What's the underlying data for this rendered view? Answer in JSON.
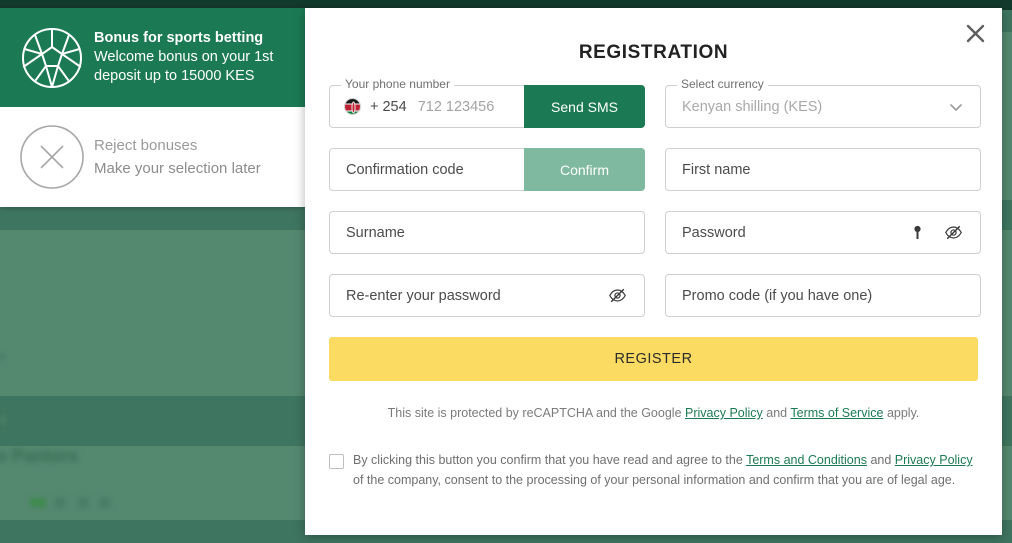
{
  "bonus_card": {
    "sports": {
      "icon": "soccer-ball-icon",
      "title": "Bonus for sports betting",
      "subtitle_line1": "Welcome bonus on your 1st",
      "subtitle_line2": "deposit up to 15000 KES"
    },
    "reject": {
      "icon": "circle-x-icon",
      "title": "Reject bonuses",
      "subtitle": "Make your selection later"
    }
  },
  "modal": {
    "title": "REGISTRATION",
    "close_icon": "close-icon",
    "phone": {
      "label": "Your phone number",
      "flag_icon": "kenya-flag-icon",
      "country_code": "+ 254",
      "placeholder": "712 123456",
      "button_label": "Send SMS"
    },
    "currency": {
      "label": "Select currency",
      "value": "Kenyan shilling (KES)",
      "chevron_icon": "chevron-down-icon"
    },
    "confirmation_code": {
      "placeholder": "Confirmation code",
      "button_label": "Confirm"
    },
    "first_name": {
      "placeholder": "First name"
    },
    "surname": {
      "placeholder": "Surname"
    },
    "password": {
      "placeholder": "Password",
      "key_icon": "key-icon",
      "toggle_icon": "eye-off-icon"
    },
    "reenter_password": {
      "placeholder": "Re-enter your password",
      "toggle_icon": "eye-off-icon"
    },
    "promo_code": {
      "placeholder": "Promo code (if you have one)"
    },
    "register_button": "REGISTER",
    "recaptcha": {
      "text_before": "This site is protected by reCAPTCHA and the Google ",
      "privacy_policy": "Privacy Policy",
      "text_middle": " and ",
      "terms_of_service": "Terms of Service",
      "text_after": " apply."
    },
    "terms": {
      "text_before": "By clicking this button you confirm that you have read and agree to the ",
      "terms_link": "Terms and Conditions",
      "text_middle": " and ",
      "privacy_link": "Privacy Policy",
      "text_after": " of the company, consent to the processing of your personal information and confirm that you are of legal age.",
      "checked": false
    }
  },
  "background": {
    "blurred_text": "to Panters",
    "overlay_color": "#54886f"
  },
  "colors": {
    "brand_green": "#1b7a54",
    "muted_green": "#7fb99f",
    "register_yellow": "#fcdb62",
    "backdrop_green": "#54886f"
  }
}
